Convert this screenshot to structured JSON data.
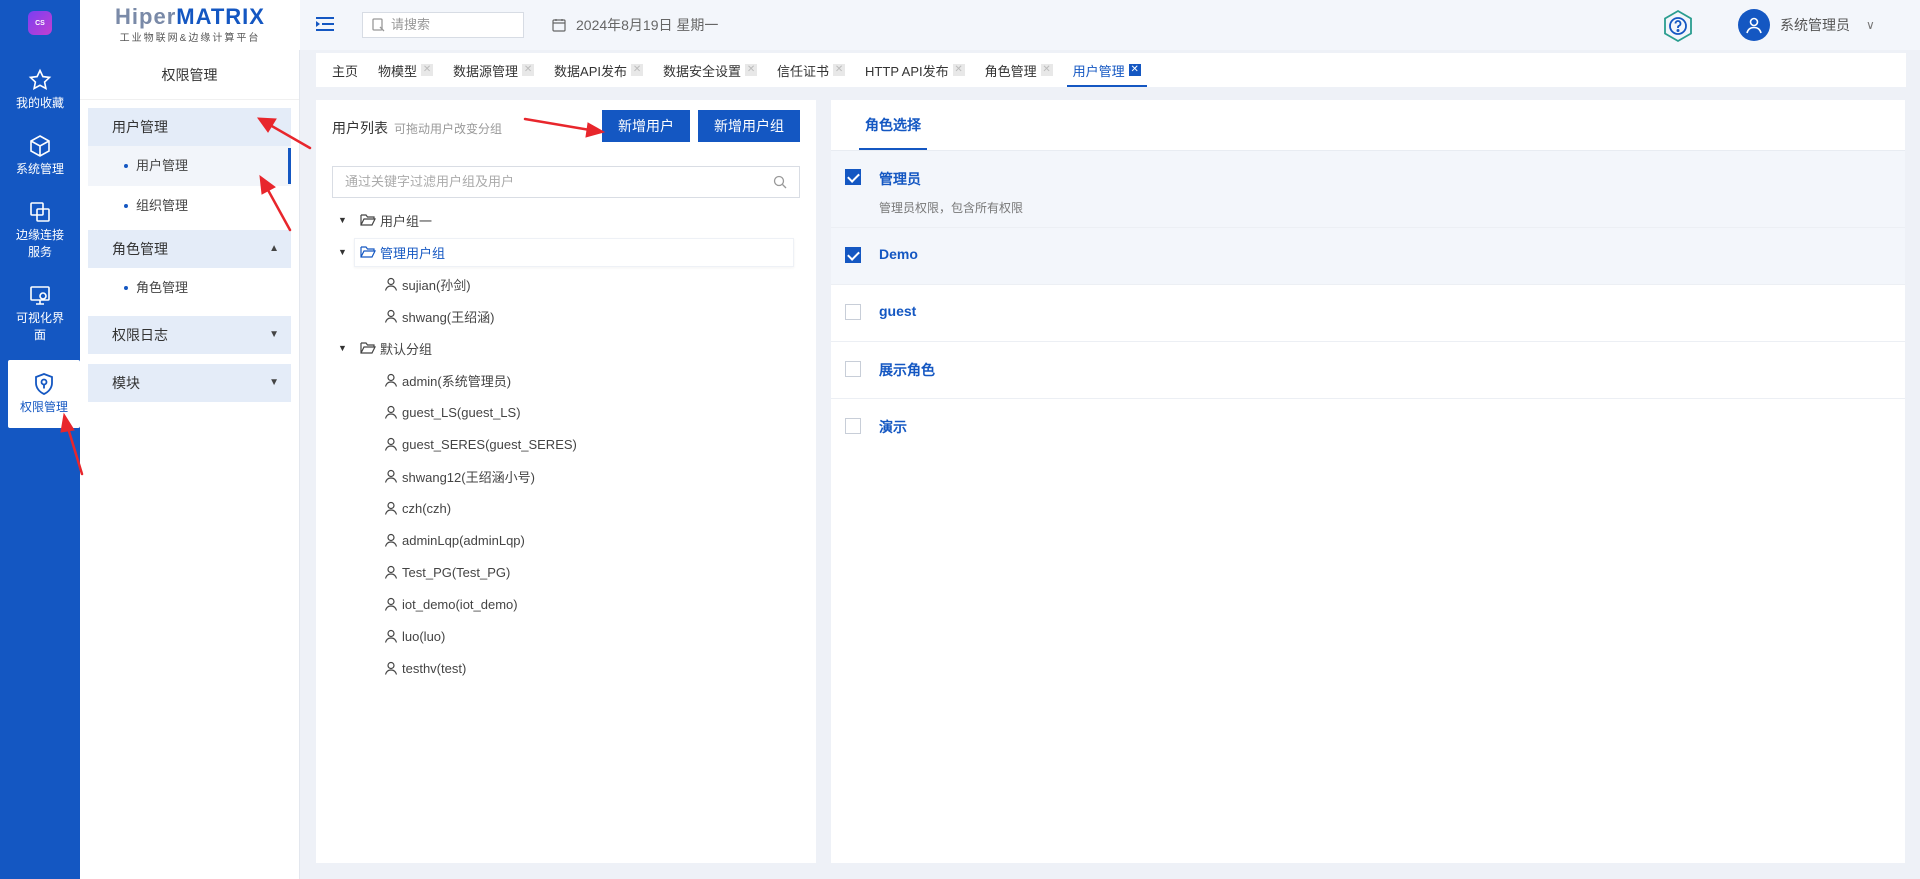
{
  "app": {
    "logo_badge": "CS",
    "brand_prefix": "Hiper",
    "brand_suffix": "MATRIX",
    "brand_sub": "工业物联网&边缘计算平台"
  },
  "rail": [
    {
      "label": "我的收藏",
      "icon": "star-icon"
    },
    {
      "label": "系统管理",
      "icon": "cube-icon"
    },
    {
      "label": "边缘连接服务",
      "icon": "link-icon"
    },
    {
      "label": "可视化界面",
      "icon": "monitor-icon"
    },
    {
      "label": "权限管理",
      "icon": "shield-icon",
      "active": true
    }
  ],
  "side": {
    "title": "权限管理",
    "groups": [
      {
        "label": "用户管理",
        "expanded": true,
        "items": [
          "用户管理",
          "组织管理"
        ],
        "active_item": "用户管理"
      },
      {
        "label": "角色管理",
        "expanded": true,
        "items": [
          "角色管理"
        ]
      },
      {
        "label": "权限日志",
        "expanded": false,
        "items": []
      },
      {
        "label": "模块",
        "expanded": false,
        "items": []
      }
    ]
  },
  "topbar": {
    "search_placeholder": "请搜索",
    "date": "2024年8月19日 星期一",
    "user_name": "系统管理员"
  },
  "tabs": [
    {
      "label": "主页",
      "closable": false
    },
    {
      "label": "物模型",
      "closable": true
    },
    {
      "label": "数据源管理",
      "closable": true
    },
    {
      "label": "数据API发布",
      "closable": true
    },
    {
      "label": "数据安全设置",
      "closable": true
    },
    {
      "label": "信任证书",
      "closable": true
    },
    {
      "label": "HTTP API发布",
      "closable": true
    },
    {
      "label": "角色管理",
      "closable": true
    },
    {
      "label": "用户管理",
      "closable": true,
      "active": true
    }
  ],
  "user_list": {
    "title": "用户列表",
    "hint": "可拖动用户改变分组",
    "add_user": "新增用户",
    "add_group": "新增用户组",
    "filter_placeholder": "通过关键字过滤用户组及用户",
    "groups": [
      {
        "name": "用户组一",
        "users": []
      },
      {
        "name": "管理用户组",
        "selected": true,
        "users": [
          "sujian(孙剑)",
          "shwang(王绍涵)"
        ]
      },
      {
        "name": "默认分组",
        "users": [
          "admin(系统管理员)",
          "guest_LS(guest_LS)",
          "guest_SERES(guest_SERES)",
          "shwang12(王绍涵小号)",
          "czh(czh)",
          "adminLqp(adminLqp)",
          "Test_PG(Test_PG)",
          "iot_demo(iot_demo)",
          "luo(luo)",
          "testhv(test)"
        ]
      }
    ]
  },
  "roles": {
    "tab_label": "角色选择",
    "items": [
      {
        "name": "管理员",
        "desc": "管理员权限，包含所有权限",
        "checked": true
      },
      {
        "name": "Demo",
        "desc": "",
        "checked": true
      },
      {
        "name": "guest",
        "desc": "",
        "checked": false
      },
      {
        "name": "展示角色",
        "desc": "",
        "checked": false
      },
      {
        "name": "演示",
        "desc": "",
        "checked": false
      }
    ]
  },
  "colors": {
    "primary": "#1457c2",
    "annotation_arrow": "#e8262c"
  }
}
